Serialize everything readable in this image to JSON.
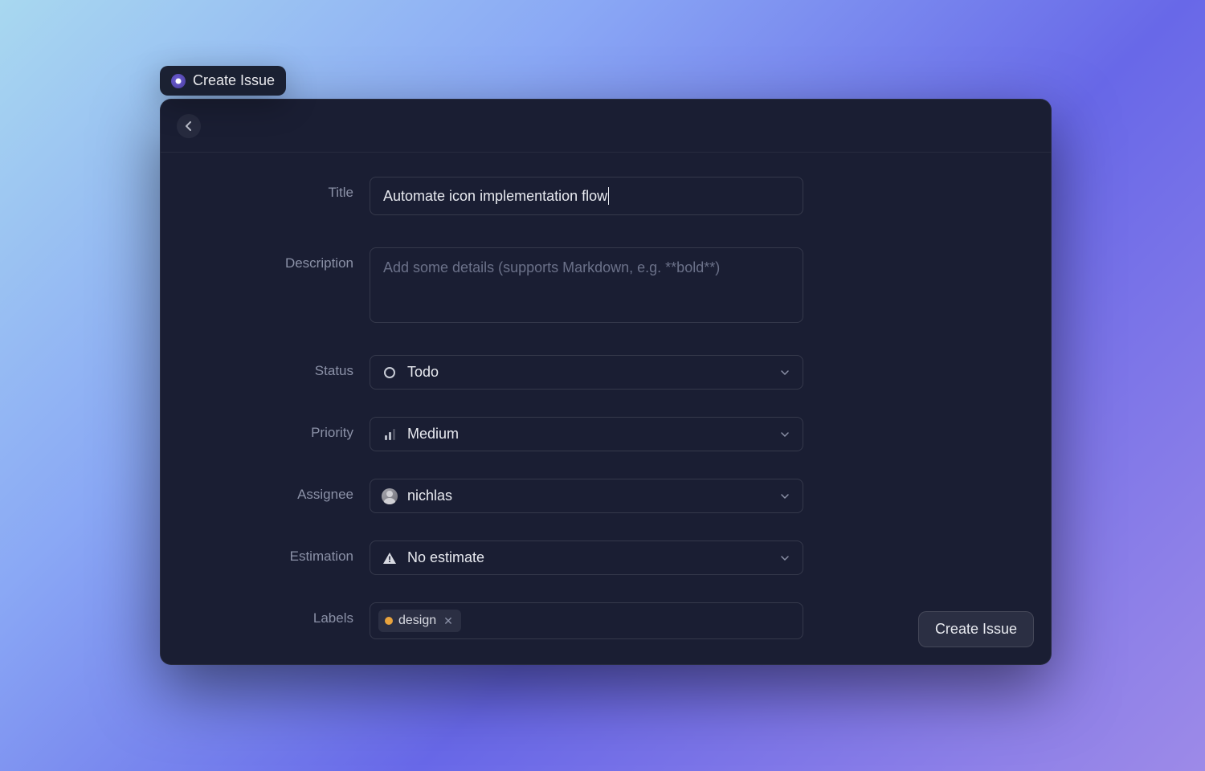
{
  "tab": {
    "label": "Create Issue"
  },
  "form": {
    "title": {
      "label": "Title",
      "value": "Automate icon implementation flow"
    },
    "description": {
      "label": "Description",
      "placeholder": "Add some details (supports Markdown, e.g. **bold**)",
      "value": ""
    },
    "status": {
      "label": "Status",
      "value": "Todo"
    },
    "priority": {
      "label": "Priority",
      "value": "Medium"
    },
    "assignee": {
      "label": "Assignee",
      "value": "nichlas"
    },
    "estimation": {
      "label": "Estimation",
      "value": "No estimate"
    },
    "labels": {
      "label": "Labels",
      "items": [
        {
          "name": "design",
          "color": "#e8a33d"
        }
      ]
    }
  },
  "actions": {
    "submit": "Create Issue"
  }
}
